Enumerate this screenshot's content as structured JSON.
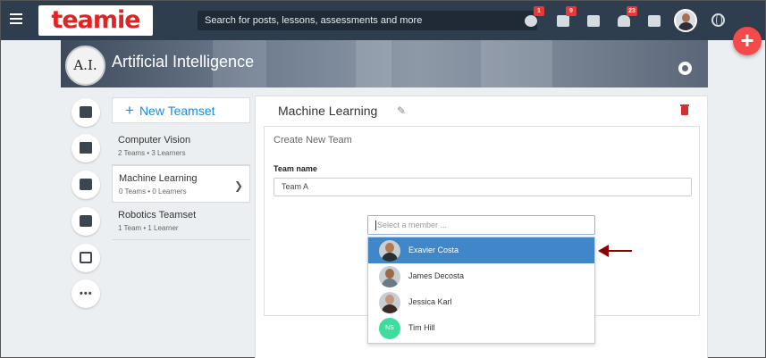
{
  "brand": {
    "logo_text": "teamie"
  },
  "topbar": {
    "search_placeholder": "Search for posts, lessons, assessments and more",
    "badges": {
      "messages": "1",
      "posts": "9",
      "notifications": "23"
    }
  },
  "banner": {
    "logo_text": "A.I.",
    "title": "Artificial Intelligence"
  },
  "teamsets": {
    "new_label": "New Teamset",
    "items": [
      {
        "name": "Computer Vision",
        "meta": "2 Teams • 3 Learners"
      },
      {
        "name": "Machine Learning",
        "meta": "0 Teams • 0 Learners"
      },
      {
        "name": "Robotics Teamset",
        "meta": "1 Team • 1 Learner"
      }
    ]
  },
  "panel": {
    "title": "Machine Learning",
    "create_title": "Create New Team",
    "team_name_label": "Team name",
    "team_name_value": "Team A"
  },
  "member_picker": {
    "placeholder": "Select a member ...",
    "members": [
      {
        "name": "Exavier Costa",
        "selected": true
      },
      {
        "name": "James Decosta"
      },
      {
        "name": "Jessica Karl"
      },
      {
        "name": "Tim Hill",
        "initials": "NS"
      }
    ]
  },
  "colors": {
    "topbar": "#2f3e4f",
    "accent": "#1e88e5",
    "selected_row": "#3f87c8",
    "fab": "#f44a4a",
    "annotation_arrow": "#8b0000"
  }
}
